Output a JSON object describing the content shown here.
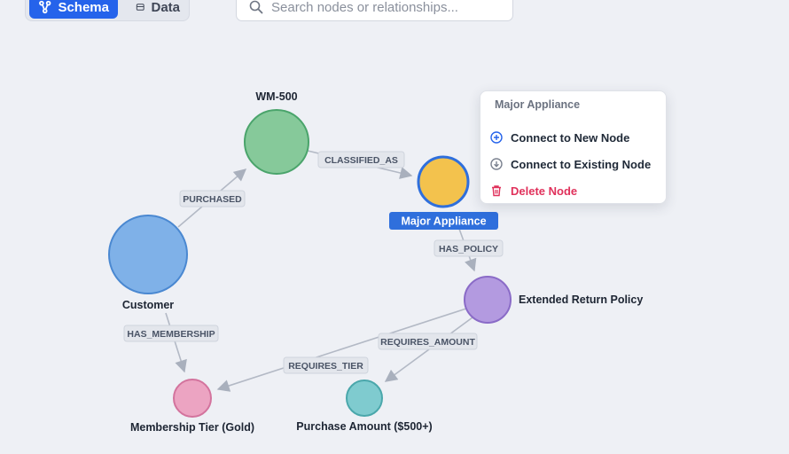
{
  "toolbar": {
    "schema_label": "Schema",
    "data_label": "Data",
    "search_placeholder": "Search nodes or relationships..."
  },
  "graph": {
    "nodes": [
      {
        "id": "wm500",
        "label": "WM-500",
        "color": "#86c99a",
        "stroke": "#4aa46b"
      },
      {
        "id": "customer",
        "label": "Customer",
        "color": "#7fb1e8",
        "stroke": "#4a88d1"
      },
      {
        "id": "appliance",
        "label": "Major Appliance",
        "color": "#f3c24d",
        "stroke": "#2f6fdc",
        "selected": true
      },
      {
        "id": "policy",
        "label": "Extended Return Policy",
        "color": "#b39ae0",
        "stroke": "#8a6bc7"
      },
      {
        "id": "tier",
        "label": "Membership Tier (Gold)",
        "color": "#eca4c2",
        "stroke": "#d3739d"
      },
      {
        "id": "amount",
        "label": "Purchase Amount ($500+)",
        "color": "#7fcbcf",
        "stroke": "#4aa7ab"
      }
    ],
    "edges": [
      {
        "from": "customer",
        "to": "wm500",
        "label": "PURCHASED"
      },
      {
        "from": "wm500",
        "to": "appliance",
        "label": "CLASSIFIED_AS"
      },
      {
        "from": "appliance",
        "to": "policy",
        "label": "HAS_POLICY"
      },
      {
        "from": "customer",
        "to": "tier",
        "label": "HAS_MEMBERSHIP"
      },
      {
        "from": "policy",
        "to": "tier",
        "label": "REQUIRES_TIER"
      },
      {
        "from": "policy",
        "to": "amount",
        "label": "REQUIRES_AMOUNT"
      }
    ]
  },
  "context_menu": {
    "title": "Major Appliance",
    "items": [
      {
        "label": "Connect to New Node",
        "icon": "plus-circle-icon"
      },
      {
        "label": "Connect to Existing Node",
        "icon": "arrow-down-circle-icon"
      },
      {
        "label": "Delete Node",
        "icon": "trash-icon",
        "danger": true
      }
    ]
  },
  "colors": {
    "accent": "#2563eb",
    "danger": "#e0315b",
    "edge": "#a9b0bd",
    "selection_label_bg": "#2f6fdc"
  }
}
